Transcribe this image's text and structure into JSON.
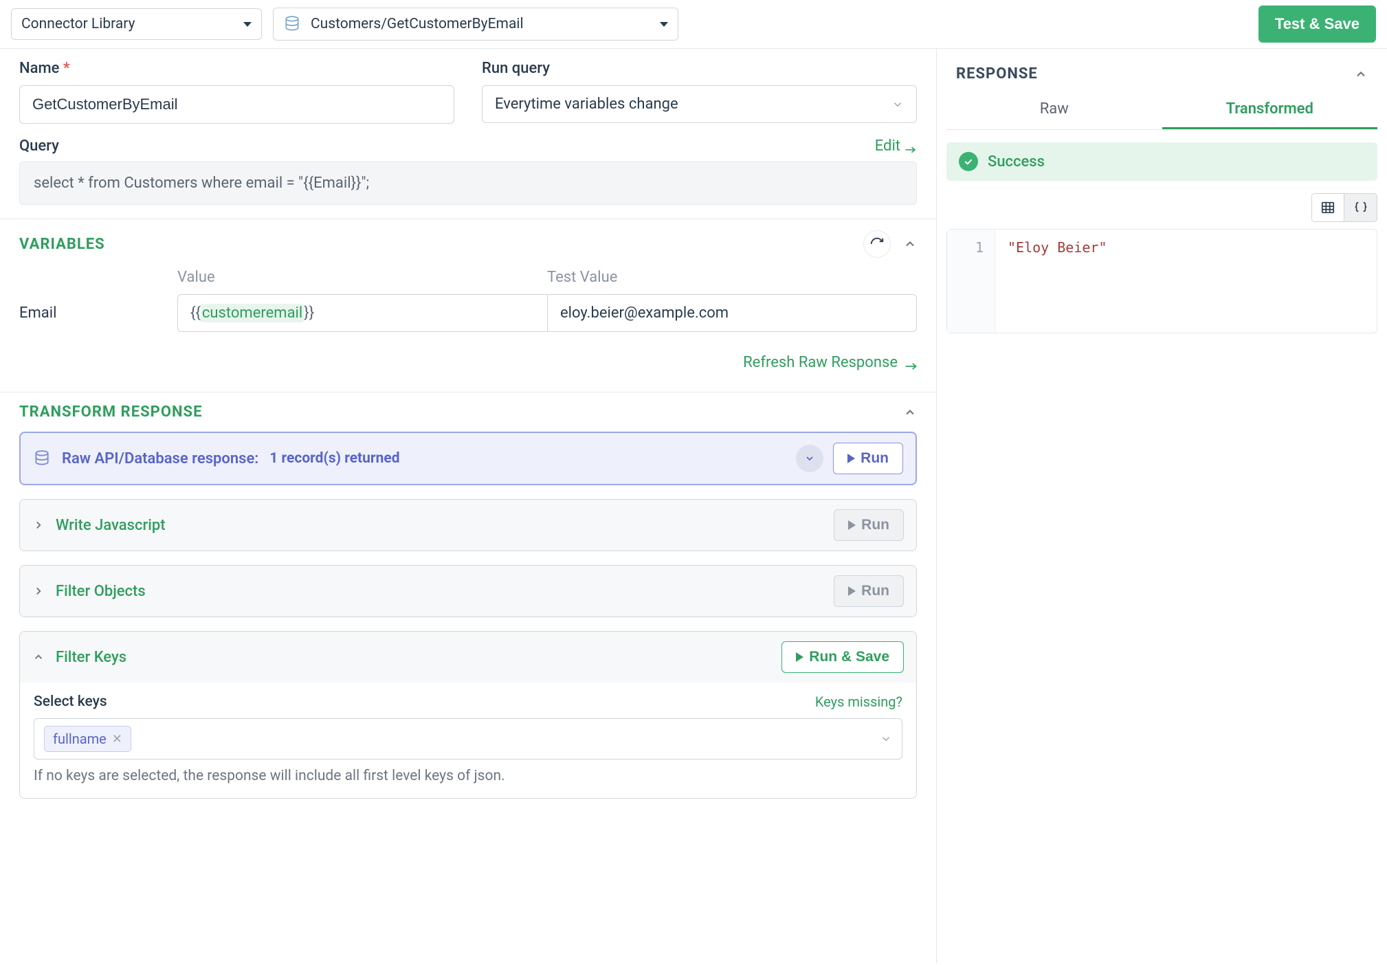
{
  "topbar": {
    "connector_dropdown": "Connector Library",
    "path_dropdown": "Customers/GetCustomerByEmail",
    "test_save": "Test & Save"
  },
  "form": {
    "name_label": "Name",
    "name_value": "GetCustomerByEmail",
    "run_query_label": "Run query",
    "run_query_value": "Everytime variables change"
  },
  "query": {
    "label": "Query",
    "edit_label": "Edit",
    "sql": "select * from Customers where email = \"{{Email}}\";"
  },
  "variables": {
    "title": "VARIABLES",
    "value_header": "Value",
    "test_value_header": "Test Value",
    "rows": [
      {
        "name": "Email",
        "value_token": "customeremail",
        "test_value": "eloy.beier@example.com"
      }
    ],
    "refresh_raw": "Refresh Raw Response"
  },
  "transform": {
    "title": "TRANSFORM RESPONSE",
    "raw_card": {
      "label": "Raw API/Database response:",
      "count": "1 record(s) returned",
      "run": "Run"
    },
    "js_card": {
      "label": "Write Javascript",
      "run": "Run"
    },
    "filter_obj_card": {
      "label": "Filter Objects",
      "run": "Run"
    },
    "filter_keys_card": {
      "label": "Filter Keys",
      "run_save": "Run & Save",
      "select_keys_label": "Select keys",
      "keys_missing": "Keys missing?",
      "tags": [
        "fullname"
      ],
      "hint": "If no keys are selected, the response will include all first level keys of json."
    }
  },
  "response": {
    "title": "RESPONSE",
    "tabs": {
      "raw": "Raw",
      "transformed": "Transformed"
    },
    "success": "Success",
    "code_lines": [
      {
        "n": "1",
        "text": "\"Eloy Beier\""
      }
    ]
  }
}
